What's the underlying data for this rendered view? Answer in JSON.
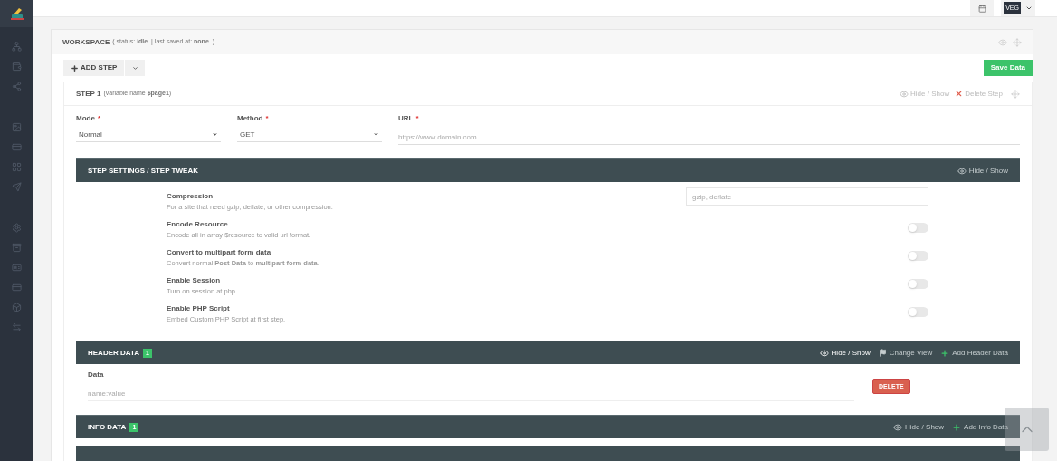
{
  "topbar": {
    "user_badge": "VEG"
  },
  "workspace": {
    "title": "WORKSPACE",
    "status": "( status: **idle.** | last saved at: **none.** )"
  },
  "toolbar": {
    "add_step": "ADD STEP",
    "save": "Save Data"
  },
  "step": {
    "title": "STEP 1",
    "variable": "(variable name **$page1**)",
    "actions": [
      {
        "kind": "eye",
        "label": "Hide / Show"
      },
      {
        "kind": "delete",
        "label": "Delete Step"
      }
    ],
    "fields": [
      {
        "kind": "select",
        "label": "Mode",
        "required_mark": "*",
        "value": "Normal"
      },
      {
        "kind": "select",
        "label": "Method",
        "required_mark": "*",
        "value": "GET"
      },
      {
        "kind": "text",
        "label": "URL",
        "required_mark": "*",
        "placeholder": "https://www.domain.com"
      }
    ],
    "settings_section": {
      "title": "STEP SETTINGS / STEP TWEAK",
      "actions": [
        {
          "kind": "eye",
          "label": "Hide / Show",
          "highlighted": false
        }
      ]
    },
    "settings": [
      {
        "kind": "input",
        "title": "Compression",
        "description": "For a site that need gzip, deflate, or other compression.",
        "placeholder": "gzip, deflate"
      },
      {
        "kind": "toggle",
        "title": "Encode Resource",
        "description": "Encode all in array $resource to valid url format.",
        "on": false
      },
      {
        "kind": "toggle",
        "title": "Convert to multipart form data",
        "description": "Convert normal **Post Data** to **multipart form data**.",
        "on": false
      },
      {
        "kind": "toggle",
        "title": "Enable Session",
        "description": "Turn on session at php.",
        "on": false
      },
      {
        "kind": "toggle",
        "title": "Enable PHP Script",
        "description": "Embed Custom PHP Script at first step.",
        "on": false
      }
    ],
    "header_data": {
      "title": "HEADER DATA",
      "count": "1",
      "actions": [
        {
          "kind": "eye",
          "label": "Hide / Show",
          "highlighted": true
        },
        {
          "kind": "flag",
          "label": "Change View",
          "highlighted": false
        },
        {
          "kind": "plus",
          "label": "Add Header Data",
          "highlighted": false
        }
      ],
      "rows": [
        {
          "label": "Data",
          "placeholder": "name:value",
          "delete": "DELETE"
        }
      ]
    },
    "info_data": {
      "title": "INFO DATA",
      "count": "1",
      "actions": [
        {
          "kind": "eye",
          "label": "Hide / Show",
          "highlighted": false
        },
        {
          "kind": "plus",
          "label": "Add Info Data",
          "highlighted": false
        }
      ]
    }
  }
}
